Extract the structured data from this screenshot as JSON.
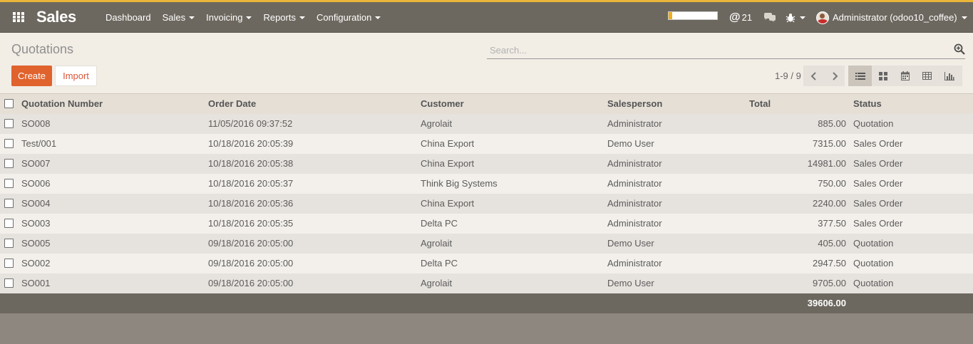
{
  "navbar": {
    "brand": "Sales",
    "menu": [
      {
        "label": "Dashboard",
        "dropdown": false
      },
      {
        "label": "Sales",
        "dropdown": true
      },
      {
        "label": "Invoicing",
        "dropdown": true
      },
      {
        "label": "Reports",
        "dropdown": true
      },
      {
        "label": "Configuration",
        "dropdown": true
      }
    ],
    "systray": {
      "progress_fraction": 0.07,
      "mentions_count": "21",
      "user_label": "Administrator (odoo10_coffee)"
    },
    "icons": [
      "apps-grid-icon",
      "at-sign-icon",
      "chat-bubbles-icon",
      "bug-icon",
      "user-avatar-icon"
    ]
  },
  "control_panel": {
    "breadcrumb": "Quotations",
    "search": {
      "placeholder": "Search...",
      "value": ""
    },
    "buttons": {
      "create": "Create",
      "import": "Import"
    },
    "pager": "1-9 / 9",
    "views": [
      "list-view-icon",
      "kanban-view-icon",
      "calendar-view-icon",
      "pivot-view-icon",
      "graph-view-icon"
    ]
  },
  "table": {
    "columns": [
      "Quotation Number",
      "Order Date",
      "Customer",
      "Salesperson",
      "Total",
      "Status"
    ],
    "rows": [
      {
        "number": "SO008",
        "date": "11/05/2016 09:37:52",
        "customer": "Agrolait",
        "salesperson": "Administrator",
        "total": "885.00",
        "status": "Quotation"
      },
      {
        "number": "Test/001",
        "date": "10/18/2016 20:05:39",
        "customer": "China Export",
        "salesperson": "Demo User",
        "total": "7315.00",
        "status": "Sales Order"
      },
      {
        "number": "SO007",
        "date": "10/18/2016 20:05:38",
        "customer": "China Export",
        "salesperson": "Administrator",
        "total": "14981.00",
        "status": "Sales Order"
      },
      {
        "number": "SO006",
        "date": "10/18/2016 20:05:37",
        "customer": "Think Big Systems",
        "salesperson": "Administrator",
        "total": "750.00",
        "status": "Sales Order"
      },
      {
        "number": "SO004",
        "date": "10/18/2016 20:05:36",
        "customer": "China Export",
        "salesperson": "Administrator",
        "total": "2240.00",
        "status": "Sales Order"
      },
      {
        "number": "SO003",
        "date": "10/18/2016 20:05:35",
        "customer": "Delta PC",
        "salesperson": "Administrator",
        "total": "377.50",
        "status": "Sales Order"
      },
      {
        "number": "SO005",
        "date": "09/18/2016 20:05:00",
        "customer": "Agrolait",
        "salesperson": "Demo User",
        "total": "405.00",
        "status": "Quotation"
      },
      {
        "number": "SO002",
        "date": "09/18/2016 20:05:00",
        "customer": "Delta PC",
        "salesperson": "Administrator",
        "total": "2947.50",
        "status": "Quotation"
      },
      {
        "number": "SO001",
        "date": "09/18/2016 20:05:00",
        "customer": "Agrolait",
        "salesperson": "Demo User",
        "total": "9705.00",
        "status": "Quotation"
      }
    ],
    "footer_total": "39606.00"
  },
  "colors": {
    "navbar_bg": "#6d685f",
    "accent": "#e9b53b",
    "create_button": "#e0622d",
    "panel_bg": "#f2ede5"
  }
}
